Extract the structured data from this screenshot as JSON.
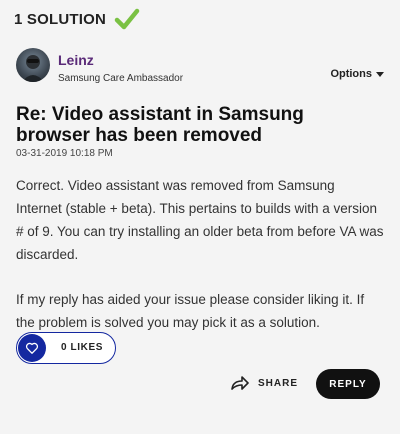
{
  "solution_header": {
    "label": "1 SOLUTION",
    "icon": "check-icon",
    "accent": "#7ac143"
  },
  "author": {
    "name": "Leinz",
    "role": "Samsung Care Ambassador",
    "name_color": "#5a2a78"
  },
  "options": {
    "label": "Options"
  },
  "post": {
    "title": "Re: Video assistant in Samsung browser has been removed",
    "date": "03-31-2019 10:18 PM",
    "paragraphs": [
      "Correct. Video assistant was removed from Samsung Internet (stable + beta). This pertains to builds with a version # of 9. You can try installing an older beta from before VA was discarded.",
      "If my reply has aided your issue please consider liking it. If the problem is solved you may pick it as a solution."
    ]
  },
  "actions": {
    "likes_label": "0 LIKES",
    "share_label": "SHARE",
    "reply_label": "REPLY",
    "like_color": "#1428a0"
  }
}
